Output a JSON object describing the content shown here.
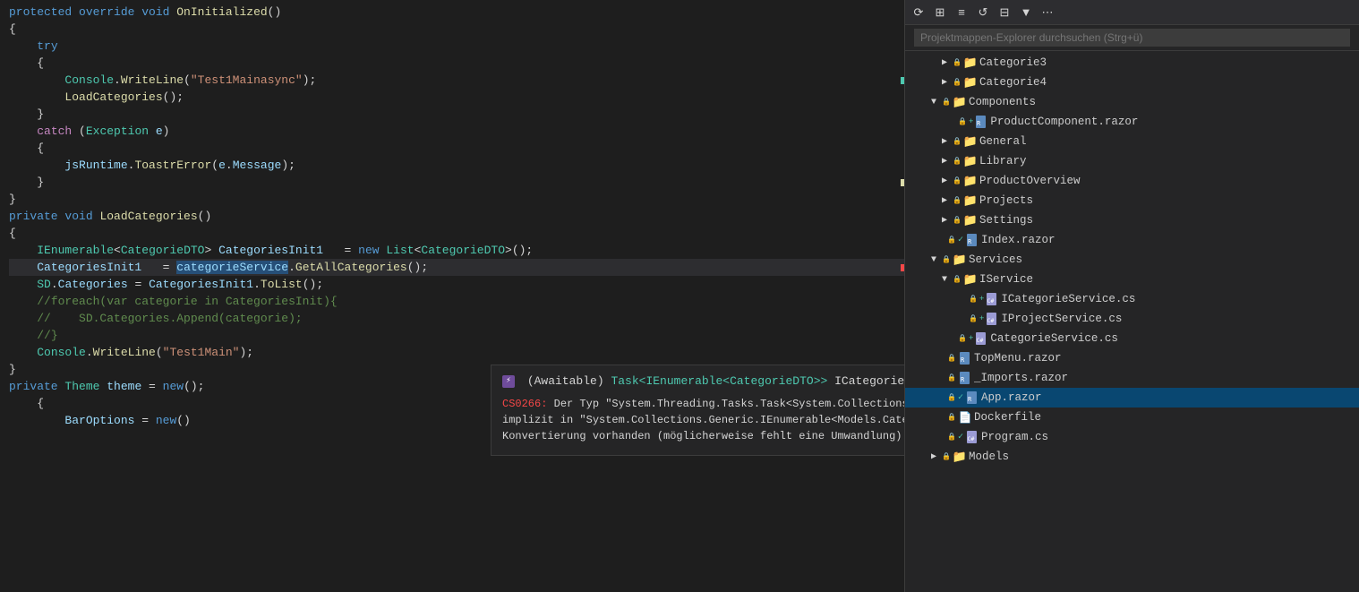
{
  "editor": {
    "title": "Code Editor",
    "lines": [
      {
        "id": 1,
        "indent": 0,
        "tokens": [
          {
            "text": "protected ",
            "cls": "kw"
          },
          {
            "text": "override ",
            "cls": "kw"
          },
          {
            "text": "void ",
            "cls": "kw"
          },
          {
            "text": "OnInitialized",
            "cls": "method"
          },
          {
            "text": "()",
            "cls": "punct"
          }
        ],
        "gutter": null
      },
      {
        "id": 2,
        "indent": 0,
        "tokens": [
          {
            "text": "{",
            "cls": "punct"
          }
        ],
        "gutter": null
      },
      {
        "id": 3,
        "indent": 1,
        "tokens": [
          {
            "text": "try",
            "cls": "kw"
          }
        ],
        "gutter": null
      },
      {
        "id": 4,
        "indent": 1,
        "tokens": [
          {
            "text": "{",
            "cls": "punct"
          }
        ],
        "gutter": null
      },
      {
        "id": 5,
        "indent": 2,
        "tokens": [
          {
            "text": "Console",
            "cls": "type"
          },
          {
            "text": ".",
            "cls": "punct"
          },
          {
            "text": "WriteLine",
            "cls": "method"
          },
          {
            "text": "(",
            "cls": "punct"
          },
          {
            "text": "\"Test1Mainasync\"",
            "cls": "str"
          },
          {
            "text": ");",
            "cls": "punct"
          }
        ],
        "gutter": "green"
      },
      {
        "id": 6,
        "indent": 2,
        "tokens": [
          {
            "text": "LoadCategories",
            "cls": "method"
          },
          {
            "text": "();",
            "cls": "punct"
          }
        ],
        "gutter": null
      },
      {
        "id": 7,
        "indent": 1,
        "tokens": [
          {
            "text": "}",
            "cls": "punct"
          }
        ],
        "gutter": null
      },
      {
        "id": 8,
        "indent": 1,
        "tokens": [
          {
            "text": "catch ",
            "cls": "kw2"
          },
          {
            "text": "(",
            "cls": "punct"
          },
          {
            "text": "Exception ",
            "cls": "type"
          },
          {
            "text": "e",
            "cls": "var"
          },
          {
            "text": ")",
            "cls": "punct"
          }
        ],
        "gutter": null
      },
      {
        "id": 9,
        "indent": 1,
        "tokens": [
          {
            "text": "{",
            "cls": "punct"
          }
        ],
        "gutter": null
      },
      {
        "id": 10,
        "indent": 0,
        "tokens": [],
        "gutter": null
      },
      {
        "id": 11,
        "indent": 2,
        "tokens": [
          {
            "text": "jsRuntime",
            "cls": "var"
          },
          {
            "text": ".",
            "cls": "punct"
          },
          {
            "text": "ToastrError",
            "cls": "method"
          },
          {
            "text": "(",
            "cls": "punct"
          },
          {
            "text": "e",
            "cls": "var"
          },
          {
            "text": ".",
            "cls": "punct"
          },
          {
            "text": "Message",
            "cls": "prop"
          },
          {
            "text": ");",
            "cls": "punct"
          }
        ],
        "gutter": null
      },
      {
        "id": 12,
        "indent": 1,
        "tokens": [
          {
            "text": "}",
            "cls": "punct"
          }
        ],
        "gutter": "yellow"
      },
      {
        "id": 13,
        "indent": 0,
        "tokens": [],
        "gutter": null
      },
      {
        "id": 14,
        "indent": 0,
        "tokens": [
          {
            "text": "}",
            "cls": "punct"
          }
        ],
        "gutter": null
      },
      {
        "id": 15,
        "indent": 0,
        "tokens": [],
        "gutter": null
      },
      {
        "id": 16,
        "indent": 0,
        "tokens": [
          {
            "text": "private ",
            "cls": "kw"
          },
          {
            "text": "void ",
            "cls": "kw"
          },
          {
            "text": "LoadCategories",
            "cls": "method"
          },
          {
            "text": "()",
            "cls": "punct"
          }
        ],
        "gutter": null
      },
      {
        "id": 17,
        "indent": 0,
        "tokens": [
          {
            "text": "{",
            "cls": "punct"
          }
        ],
        "gutter": null
      },
      {
        "id": 18,
        "indent": 0,
        "tokens": [],
        "gutter": null
      },
      {
        "id": 19,
        "indent": 1,
        "tokens": [
          {
            "text": "IEnumerable",
            "cls": "type"
          },
          {
            "text": "<",
            "cls": "punct"
          },
          {
            "text": "CategorieDTO",
            "cls": "type"
          },
          {
            "text": "> ",
            "cls": "punct"
          },
          {
            "text": "CategoriesInit1",
            "cls": "var"
          },
          {
            "text": "   = ",
            "cls": "punct"
          },
          {
            "text": "new ",
            "cls": "kw"
          },
          {
            "text": "List",
            "cls": "type"
          },
          {
            "text": "<",
            "cls": "punct"
          },
          {
            "text": "CategorieDTO",
            "cls": "type"
          },
          {
            "text": ">();",
            "cls": "punct"
          }
        ],
        "gutter": null
      },
      {
        "id": 20,
        "indent": 1,
        "tokens": [
          {
            "text": "CategoriesInit1",
            "cls": "var"
          },
          {
            "text": "   = ",
            "cls": "punct"
          },
          {
            "text": "categorieService",
            "cls": "selected-word"
          },
          {
            "text": ".",
            "cls": "punct"
          },
          {
            "text": "GetAllCategories",
            "cls": "method"
          },
          {
            "text": "();",
            "cls": "punct"
          }
        ],
        "gutter": "red",
        "selected": true
      },
      {
        "id": 21,
        "indent": 0,
        "tokens": [],
        "gutter": null
      },
      {
        "id": 22,
        "indent": 1,
        "tokens": [
          {
            "text": "SD",
            "cls": "type"
          },
          {
            "text": ".",
            "cls": "punct"
          },
          {
            "text": "Categories",
            "cls": "prop"
          },
          {
            "text": " = ",
            "cls": "punct"
          },
          {
            "text": "CategoriesInit1",
            "cls": "var"
          },
          {
            "text": ".",
            "cls": "punct"
          },
          {
            "text": "ToList",
            "cls": "method"
          },
          {
            "text": "();",
            "cls": "punct"
          }
        ],
        "gutter": null
      },
      {
        "id": 23,
        "indent": 1,
        "tokens": [
          {
            "text": "//foreach(var categorie in CategoriesInit){",
            "cls": "comment"
          }
        ],
        "gutter": null
      },
      {
        "id": 24,
        "indent": 1,
        "tokens": [
          {
            "text": "//    SD.Categories.Append(categorie);",
            "cls": "comment"
          }
        ],
        "gutter": null
      },
      {
        "id": 25,
        "indent": 1,
        "tokens": [
          {
            "text": "//}",
            "cls": "comment"
          }
        ],
        "gutter": null
      },
      {
        "id": 26,
        "indent": 0,
        "tokens": [],
        "gutter": null
      },
      {
        "id": 27,
        "indent": 1,
        "tokens": [
          {
            "text": "Console",
            "cls": "type"
          },
          {
            "text": ".",
            "cls": "punct"
          },
          {
            "text": "WriteLine",
            "cls": "method"
          },
          {
            "text": "(",
            "cls": "punct"
          },
          {
            "text": "\"Test1Main\"",
            "cls": "str"
          },
          {
            "text": ");",
            "cls": "punct"
          }
        ],
        "gutter": null
      },
      {
        "id": 28,
        "indent": 0,
        "tokens": [],
        "gutter": null
      },
      {
        "id": 29,
        "indent": 0,
        "tokens": [],
        "gutter": null
      },
      {
        "id": 30,
        "indent": 0,
        "tokens": [
          {
            "text": "}",
            "cls": "punct"
          }
        ],
        "gutter": null
      },
      {
        "id": 31,
        "indent": 0,
        "tokens": [],
        "gutter": null
      },
      {
        "id": 32,
        "indent": 0,
        "tokens": [
          {
            "text": "private ",
            "cls": "kw"
          },
          {
            "text": "Theme ",
            "cls": "type"
          },
          {
            "text": "theme",
            "cls": "var"
          },
          {
            "text": " = ",
            "cls": "punct"
          },
          {
            "text": "new",
            "cls": "kw"
          },
          {
            "text": "();",
            "cls": "punct"
          }
        ],
        "gutter": null
      },
      {
        "id": 33,
        "indent": 1,
        "tokens": [
          {
            "text": "{",
            "cls": "punct"
          }
        ],
        "gutter": null
      },
      {
        "id": 34,
        "indent": 2,
        "tokens": [
          {
            "text": "BarOptions",
            "cls": "prop"
          },
          {
            "text": " = ",
            "cls": "punct"
          },
          {
            "text": "new",
            "cls": "kw"
          },
          {
            "text": "()",
            "cls": "punct"
          }
        ],
        "gutter": null
      }
    ]
  },
  "intellisense": {
    "icon": "awaitable-icon",
    "signature": "(Awaitable) Task<IEnumerable<CategorieDTO>> ICategorieService.GetAllCategories()",
    "awaitable_label": "(Awaitable)",
    "type_label": "Task<IEnumerable<CategorieDTO>>",
    "method_label": "ICategorieService.GetAllCategories()",
    "error_code": "CS0266:",
    "error_message": "Der Typ \"System.Threading.Tasks.Task<System.Collections.Generic.IEnumerable<Models.CategorieDTO>>\" kann nicht implizit in \"System.Collections.Generic.IEnumerable<Models.CategorieDTO>\" konvertiert werden. Es ist bereits eine explizite Konvertierung vorhanden (möglicherweise fehlt eine Umwandlung)."
  },
  "solution_explorer": {
    "search_placeholder": "Projektmappen-Explorer durchsuchen (Strg+ü)",
    "items": [
      {
        "id": "cat3",
        "label": "Categorie3",
        "type": "folder",
        "level": 3,
        "locked": true,
        "expanded": false
      },
      {
        "id": "cat4",
        "label": "Categorie4",
        "type": "folder",
        "level": 3,
        "locked": true,
        "expanded": false
      },
      {
        "id": "components",
        "label": "Components",
        "type": "folder",
        "level": 2,
        "locked": true,
        "expanded": true
      },
      {
        "id": "productcomp",
        "label": "ProductComponent.razor",
        "type": "razor",
        "level": 4,
        "locked": true,
        "plus": true
      },
      {
        "id": "general",
        "label": "General",
        "type": "folder",
        "level": 3,
        "locked": true,
        "expanded": false
      },
      {
        "id": "library",
        "label": "Library",
        "type": "folder",
        "level": 3,
        "locked": true,
        "expanded": false
      },
      {
        "id": "productoverview",
        "label": "ProductOverview",
        "type": "folder",
        "level": 3,
        "locked": true,
        "expanded": false
      },
      {
        "id": "projects",
        "label": "Projects",
        "type": "folder",
        "level": 3,
        "locked": true,
        "expanded": false,
        "collapsed": true
      },
      {
        "id": "settings",
        "label": "Settings",
        "type": "folder",
        "level": 3,
        "locked": true,
        "expanded": false
      },
      {
        "id": "indexrazor",
        "label": "Index.razor",
        "type": "razor",
        "level": 3,
        "locked": true,
        "check": true
      },
      {
        "id": "services",
        "label": "Services",
        "type": "folder",
        "level": 2,
        "locked": true,
        "expanded": true
      },
      {
        "id": "iservice",
        "label": "IService",
        "type": "folder",
        "level": 3,
        "locked": true,
        "expanded": true
      },
      {
        "id": "icatservice",
        "label": "ICategorieService.cs",
        "type": "cs",
        "level": 5,
        "locked": true,
        "plus": true
      },
      {
        "id": "iprojservice",
        "label": "IProjectService.cs",
        "type": "cs",
        "level": 5,
        "locked": true,
        "plus": true
      },
      {
        "id": "catservice",
        "label": "CategorieService.cs",
        "type": "cs",
        "level": 4,
        "locked": true,
        "plus": true
      },
      {
        "id": "topmenu",
        "label": "TopMenu.razor",
        "type": "razor",
        "level": 3,
        "locked": true
      },
      {
        "id": "imports",
        "label": "_Imports.razor",
        "type": "razor",
        "level": 3,
        "locked": true
      },
      {
        "id": "apprazor",
        "label": "App.razor",
        "type": "razor",
        "level": 3,
        "locked": true,
        "check": true,
        "selected": true
      },
      {
        "id": "dockerfile",
        "label": "Dockerfile",
        "type": "file",
        "level": 3,
        "locked": true,
        "collapsed": true
      },
      {
        "id": "program",
        "label": "Program.cs",
        "type": "cs",
        "level": 3,
        "locked": true,
        "check": true
      },
      {
        "id": "models",
        "label": "Models",
        "type": "folder",
        "level": 2,
        "locked": true,
        "collapsed": true
      }
    ]
  }
}
